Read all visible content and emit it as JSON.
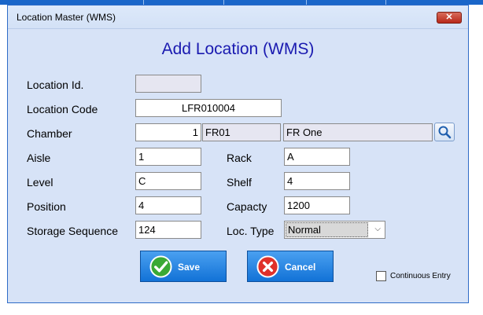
{
  "window": {
    "title": "Location Master (WMS)",
    "close_glyph": "✕"
  },
  "heading": "Add Location (WMS)",
  "fields": {
    "location_id": {
      "label": "Location Id.",
      "value": ""
    },
    "location_code": {
      "label": "Location Code",
      "value": "LFR010004"
    },
    "chamber": {
      "label": "Chamber",
      "value": "1",
      "code": "FR01",
      "name": "FR One"
    },
    "aisle": {
      "label": "Aisle",
      "value": "1"
    },
    "rack": {
      "label": "Rack",
      "value": "A"
    },
    "level": {
      "label": "Level",
      "value": "C"
    },
    "shelf": {
      "label": "Shelf",
      "value": "4"
    },
    "position": {
      "label": "Position",
      "value": "4"
    },
    "capacity": {
      "label": "Capacty",
      "value": "1200"
    },
    "storage_sequence": {
      "label": "Storage Sequence",
      "value": "124"
    },
    "loc_type": {
      "label": "Loc. Type",
      "selected": "Normal"
    }
  },
  "buttons": {
    "save": "Save",
    "cancel": "Cancel"
  },
  "continuous_entry": {
    "label": "Continuous Entry",
    "checked": false
  },
  "icons": {
    "search": "magnifier-icon",
    "save": "checkmark-icon",
    "cancel": "x-icon",
    "dropdown": "chevron-down-icon"
  },
  "colors": {
    "window_bg": "#d7e3f7",
    "heading": "#1a1ab0",
    "button": "#1f7fe0",
    "readonly_field": "#e6e6f1"
  }
}
